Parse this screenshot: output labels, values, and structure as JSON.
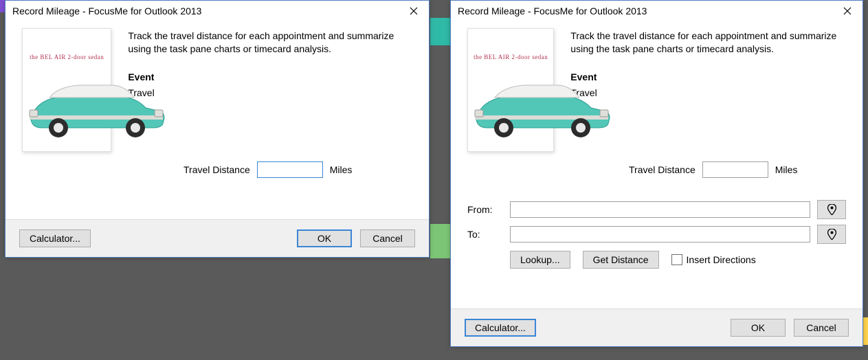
{
  "window_title": "Record Mileage - FocusMe for Outlook 2013",
  "belair_label": "the BEL AIR 2-door sedan",
  "description": "Track the travel distance for each appointment and summarize using the task pane charts or timecard analysis.",
  "event_heading": "Event",
  "event_name": "Travel",
  "distance_label": "Travel Distance",
  "distance_units": "Miles",
  "buttons": {
    "calculator": "Calculator...",
    "ok": "OK",
    "cancel": "Cancel"
  },
  "calc": {
    "from_label": "From:",
    "to_label": "To:",
    "lookup": "Lookup...",
    "get_distance": "Get Distance",
    "insert_directions": "Insert Directions"
  },
  "left_distance_value": "",
  "right_distance_value": "",
  "from_value": "",
  "to_value": "",
  "insert_directions_checked": false
}
